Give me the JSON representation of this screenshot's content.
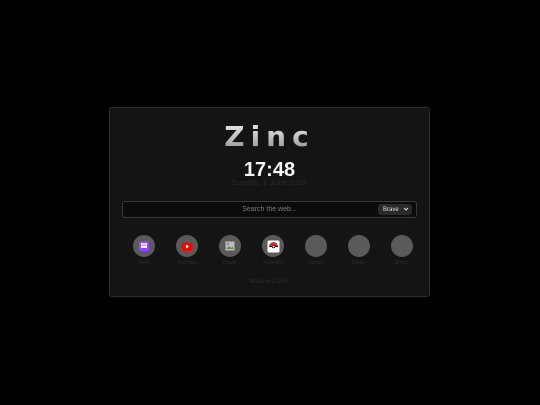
{
  "app": {
    "logo": "Zinc",
    "time": "17:48",
    "date": "Sunday, 1 June 2025"
  },
  "search": {
    "placeholder": "Search the web...",
    "engine": "Brave"
  },
  "shortcuts": [
    {
      "label": "Twitch",
      "icon": "twitch-icon",
      "color": "#9146ff"
    },
    {
      "label": "YouTube",
      "icon": "youtube-icon",
      "color": "#ff0000"
    },
    {
      "label": "Image",
      "icon": "broken-image-icon",
      "color": "#7a7a7a"
    },
    {
      "label": "PokeAPI",
      "icon": "pokeball-icon",
      "color": "#d32f2f"
    },
    {
      "label": "Empty",
      "icon": "blank-icon",
      "color": "#5a5a5a"
    },
    {
      "label": "Empty",
      "icon": "blank-icon",
      "color": "#5a5a5a"
    },
    {
      "label": "Empty",
      "icon": "blank-icon",
      "color": "#5a5a5a"
    }
  ],
  "footer": {
    "text": "Made with Zinc"
  }
}
